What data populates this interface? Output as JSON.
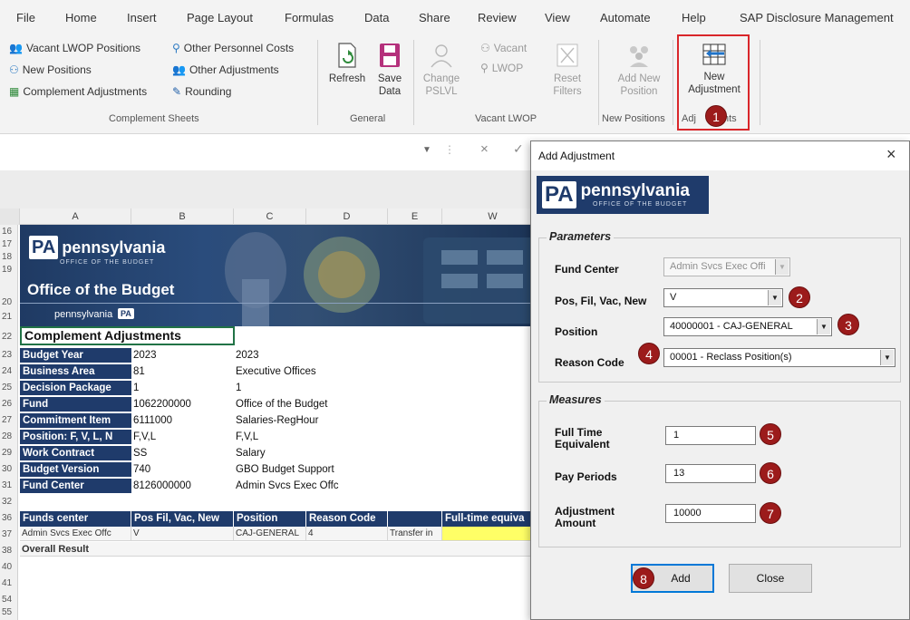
{
  "menu": [
    "File",
    "Home",
    "Insert",
    "Page Layout",
    "Formulas",
    "Data",
    "Share",
    "Review",
    "View",
    "Automate",
    "Help",
    "SAP Disclosure Management"
  ],
  "ribbon": {
    "complement_items": [
      "Vacant LWOP Positions",
      "New Positions",
      "Complement Adjustments",
      "Other Personnel Costs",
      "Other Adjustments",
      "Rounding"
    ],
    "complement_label": "Complement Sheets",
    "refresh": "Refresh",
    "save_l1": "Save",
    "save_l2": "Data",
    "general_label": "General",
    "change_l1": "Change",
    "change_l2": "PSLVL",
    "vacant": "Vacant",
    "lwop": "LWOP",
    "reset_l1": "Reset",
    "reset_l2": "Filters",
    "vacant_lwop_label": "Vacant LWOP",
    "addnew_l1": "Add New",
    "addnew_l2": "Position",
    "new_positions_label": "New Positions",
    "newadj_l1": "New",
    "newadj_l2": "Adjustment",
    "adjustments_label_a": "Adj",
    "adjustments_label_b": "nts"
  },
  "formula_bar": {
    "cancel": "×",
    "enter": "✓"
  },
  "sheet": {
    "columns": [
      "A",
      "B",
      "C",
      "D",
      "E",
      "W"
    ],
    "row_numbers": [
      "16",
      "17",
      "18",
      "19",
      "20",
      "21",
      "22",
      "23",
      "24",
      "25",
      "26",
      "27",
      "28",
      "29",
      "30",
      "31",
      "32",
      "36",
      "37",
      "38",
      "40",
      "41",
      "54",
      "55"
    ],
    "banner": {
      "pa": "PA",
      "pennsylvania": "pennsylvania",
      "office_small": "OFFICE OF THE BUDGET",
      "office": "Office of the Budget",
      "footer_word": "pennsylvania",
      "footer_pa": "PA"
    },
    "title": "Complement Adjustments",
    "params": [
      {
        "label": "Budget Year",
        "code": "2023",
        "text": "2023"
      },
      {
        "label": "Business Area",
        "code": "81",
        "text": "Executive Offices"
      },
      {
        "label": "Decision Package",
        "code": "1",
        "text": "1"
      },
      {
        "label": "Fund",
        "code": "1062200000",
        "text": "Office of the Budget"
      },
      {
        "label": "Commitment Item",
        "code": "6111000",
        "text": "Salaries-RegHour"
      },
      {
        "label": "Position: F, V, L, N",
        "code": "F,V,L",
        "text": "F,V,L"
      },
      {
        "label": "Work Contract",
        "code": "SS",
        "text": "Salary"
      },
      {
        "label": "Budget Version",
        "code": "740",
        "text": "GBO Budget Support"
      },
      {
        "label": "Fund Center",
        "code": "8126000000",
        "text": "Admin Svcs Exec Offc"
      }
    ],
    "table_headers": [
      "Funds center",
      "Pos Fil, Vac, New",
      "Position",
      "Reason Code",
      "",
      "Full-time equiva"
    ],
    "row37": [
      "Admin Svcs Exec Offc",
      "V",
      "CAJ-GENERAL",
      "4",
      "Transfer in",
      ""
    ],
    "overall": "Overall Result"
  },
  "dialog": {
    "title": "Add Adjustment",
    "close": "×",
    "logo_pa": "PA",
    "logo_word": "pennsylvania",
    "logo_sub": "OFFICE OF THE BUDGET",
    "parameters_title": "Parameters",
    "fund_center_label": "Fund Center",
    "fund_center_value": "Admin Svcs Exec Offi",
    "posfil_label": "Pos, Fil, Vac, New",
    "posfil_value": "V",
    "position_label": "Position",
    "position_value": "40000001 - CAJ-GENERAL",
    "reason_label": "Reason Code",
    "reason_value": "00001 - Reclass Position(s)",
    "measures_title": "Measures",
    "fte_label_1": "Full Time",
    "fte_label_2": "Equivalent",
    "fte_value": "1",
    "pay_label": "Pay Periods",
    "pay_value": "13",
    "amount_label_1": "Adjustment",
    "amount_label_2": "Amount",
    "amount_value": "10000",
    "add": "Add",
    "close_btn": "Close"
  },
  "badges": [
    "1",
    "2",
    "3",
    "4",
    "5",
    "6",
    "7",
    "8"
  ],
  "colors": {
    "accent_red": "#d9262a",
    "badge": "#9c1b1b",
    "navy": "#1f3b6b",
    "highlight_yellow": "#ffff66"
  }
}
